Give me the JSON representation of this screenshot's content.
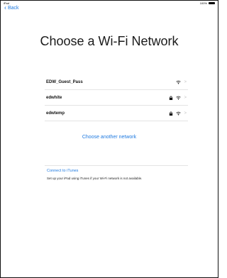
{
  "status_bar": {
    "device": "iPad",
    "battery": "100%"
  },
  "nav": {
    "back_label": "Back"
  },
  "title": "Choose a Wi-Fi Network",
  "networks": [
    {
      "name": "EDW_Guest_Pass",
      "locked": false
    },
    {
      "name": "edwhite",
      "locked": true
    },
    {
      "name": "edwtemp",
      "locked": true
    }
  ],
  "choose_another": "Choose another network",
  "itunes": {
    "link": "Connect to iTunes",
    "description": "Set up your iPad using iTunes if your Wi-Fi network is not available."
  },
  "colors": {
    "accent": "#1f7ae0",
    "text": "#111111",
    "divider": "#e4e4e4"
  },
  "icons": {
    "wifi": "wifi-icon",
    "lock": "lock-icon",
    "chevron": "chevron-right-icon",
    "back": "chevron-left-icon"
  }
}
